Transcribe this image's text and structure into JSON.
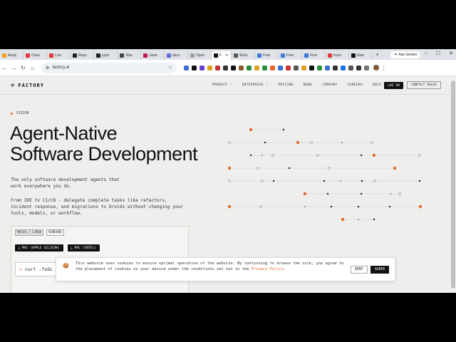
{
  "browser": {
    "tabs": [
      {
        "label": "Analy",
        "color": "#f4a11a"
      },
      {
        "label": "Chan",
        "color": "#e53935"
      },
      {
        "label": "Live",
        "color": "#e53935"
      },
      {
        "label": "Repo",
        "color": "#222222"
      },
      {
        "label": "joyle",
        "color": "#222222"
      },
      {
        "label": "Vibe",
        "color": "#444444"
      },
      {
        "label": "Junie",
        "color": "#c2185b"
      },
      {
        "label": "deco",
        "color": "#5b6cd6"
      },
      {
        "label": "Open",
        "color": "#9e9e9e"
      },
      {
        "label": "F",
        "color": "#111111",
        "active": true
      },
      {
        "label": "Work",
        "color": "#555555"
      },
      {
        "label": "Free",
        "color": "#3b7dd8"
      },
      {
        "label": "Free",
        "color": "#3b7dd8"
      },
      {
        "label": "Free",
        "color": "#3b7dd8"
      },
      {
        "label": "Insur",
        "color": "#e53935"
      },
      {
        "label": "New",
        "color": "#111111"
      }
    ],
    "new_tab": "+",
    "gemini_label": "Ask Gemini",
    "url": "factory.ai",
    "extension_colors": [
      "#3b6fd6",
      "#111111",
      "#6b3fd6",
      "#e0a020",
      "#c33",
      "#333333",
      "#111111",
      "#8b5a2b",
      "#2a8f3a",
      "#e0a020",
      "#2a8f3a",
      "#e8672e",
      "#3b6fd6",
      "#c33",
      "#555555",
      "#e0a020",
      "#111111",
      "#2a8f3a",
      "#3b6fd6",
      "#333333",
      "#1a73e8",
      "#555555",
      "#333333",
      "#777777"
    ]
  },
  "site": {
    "logo": "FACTORY",
    "nav": [
      "PRODUCT ›",
      "ENTERPRISE ›",
      "PRICING",
      "NEWS",
      "COMPANY",
      "CAREERS",
      "DOCS"
    ],
    "login": "LOG IN",
    "contact": "CONTACT SALES",
    "eyebrow": "VISION",
    "hero_line1": "Agent-Native",
    "hero_line2": "Software Development",
    "sub1": "The only software development agents that work everywhere you do.",
    "sub2": "From IDE to CI/CD - delegate complete tasks like refactors, incident response, and migrations to Droids without changing your tools, models, or workflow.",
    "os_tabs": [
      "MACOS / LINUX",
      "WINDOWS"
    ],
    "downloads": [
      "MAC (APPLE SILICON)",
      "MAC (INTEL)"
    ],
    "curl_text": "curl -fsSL h",
    "accent": "#e8672e"
  },
  "cookie": {
    "text": "This website uses cookies to ensure optimal operation of the website. By continuing to browse the site, you agree to the placement of cookies on your device under the conditions set out in the",
    "link": "Privacy Policy",
    "link_tail": ".",
    "deny": "DENY",
    "agree": "AGREE"
  }
}
